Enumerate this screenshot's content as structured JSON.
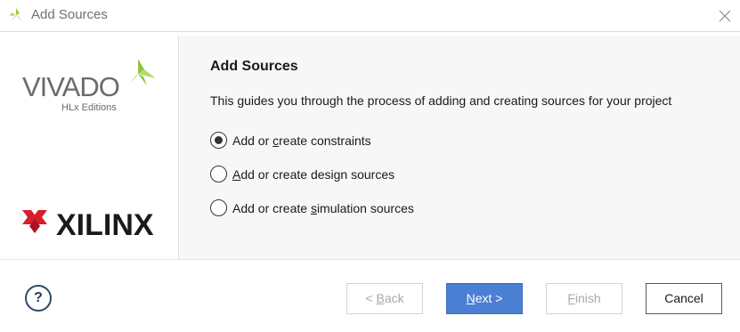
{
  "window": {
    "title": "Add Sources",
    "icon": "vivado-leaf-icon",
    "close_icon": "close-icon"
  },
  "sidebar": {
    "vivado_logo": {
      "wordmark": "VIVADO",
      "edition": "HLx Editions"
    },
    "xilinx_logo": {
      "wordmark": "XILINX"
    }
  },
  "main": {
    "heading": "Add Sources",
    "description": "This guides you through the process of adding and creating sources for your project",
    "options": [
      {
        "pre": "Add or ",
        "mnemonic": "c",
        "post": "reate constraints",
        "selected": true
      },
      {
        "pre": "",
        "mnemonic": "A",
        "post": "dd or create design sources",
        "selected": false
      },
      {
        "pre": "Add or create ",
        "mnemonic": "s",
        "post": "imulation sources",
        "selected": false
      }
    ]
  },
  "footer": {
    "help_label": "?",
    "back": {
      "pre": "< ",
      "mnemonic": "B",
      "post": "ack",
      "enabled": false
    },
    "next": {
      "pre": "",
      "mnemonic": "N",
      "post": "ext >",
      "enabled": true
    },
    "finish": {
      "pre": "",
      "mnemonic": "F",
      "post": "inish",
      "enabled": false
    },
    "cancel": {
      "label": "Cancel",
      "enabled": true
    }
  },
  "colors": {
    "accent_blue": "#4a7fd3",
    "vivado_green": "#8dc63f",
    "xilinx_red": "#d71e2a"
  }
}
